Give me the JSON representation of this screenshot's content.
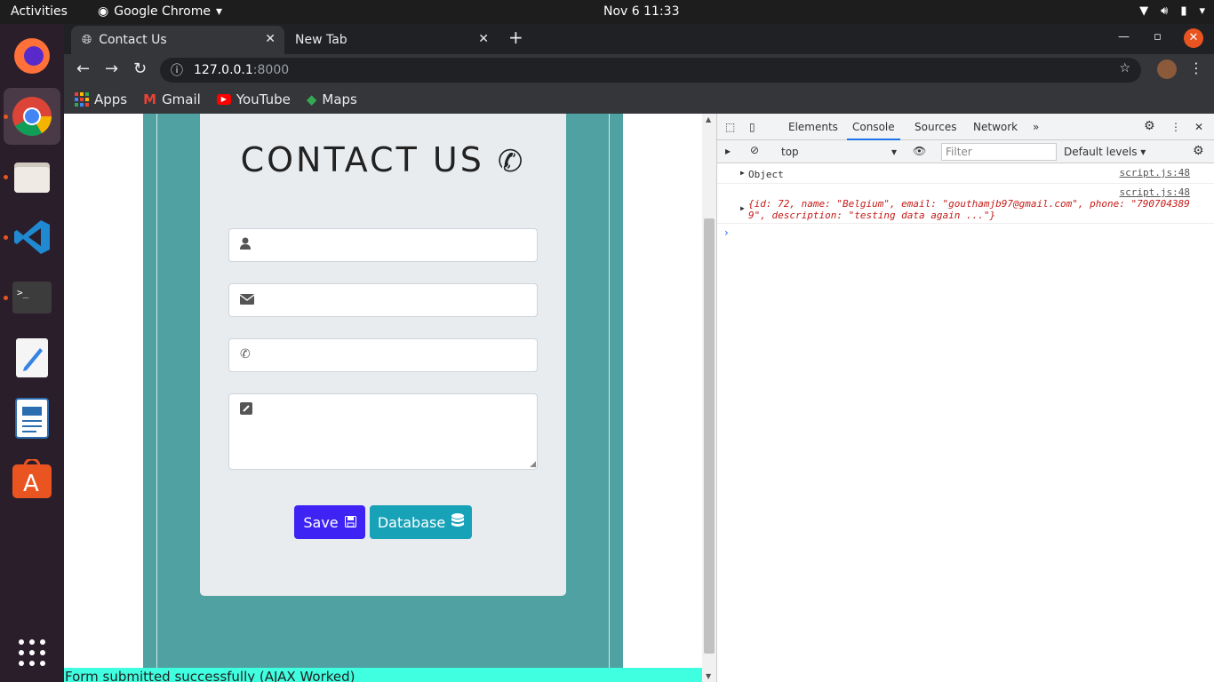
{
  "topbar": {
    "activities": "Activities",
    "app_name": "Google Chrome",
    "clock": "Nov 6  11:33"
  },
  "dock": {
    "items": [
      "firefox-icon",
      "chrome-icon",
      "files-icon",
      "vscode-icon",
      "terminal-icon",
      "text-editor-icon",
      "writer-icon",
      "software-icon",
      "app-grid-icon"
    ]
  },
  "tabs": [
    {
      "label": "Contact Us"
    },
    {
      "label": "New Tab"
    }
  ],
  "omnibox": {
    "host": "127.0.0.1",
    "port": ":8000"
  },
  "bookmarks": {
    "apps": "Apps",
    "gmail": "Gmail",
    "youtube": "YouTube",
    "maps": "Maps"
  },
  "page": {
    "title": "CONTACT US",
    "save_label": "Save",
    "database_label": "Database",
    "status": "Form submitted successfully (AJAX Worked)"
  },
  "devtools": {
    "tabs": [
      "Elements",
      "Console",
      "Sources",
      "Network"
    ],
    "context": "top",
    "filter_placeholder": "Filter",
    "levels": "Default levels",
    "log1": {
      "text": "Object",
      "source": "script.js:48"
    },
    "log2": {
      "source": "script.js:48",
      "line1": "{id: 72, name: \"Belgium\", email: \"gouthamjb97@gmail.com\", phone: \"790704389",
      "line2": "9\", description: \"testing data again ...\"}"
    }
  },
  "colors": {
    "teal": "#4fa2a1",
    "card": "#e9ecef",
    "save": "#3d24f4",
    "database": "#17a2b8",
    "status": "#40ffe0"
  }
}
